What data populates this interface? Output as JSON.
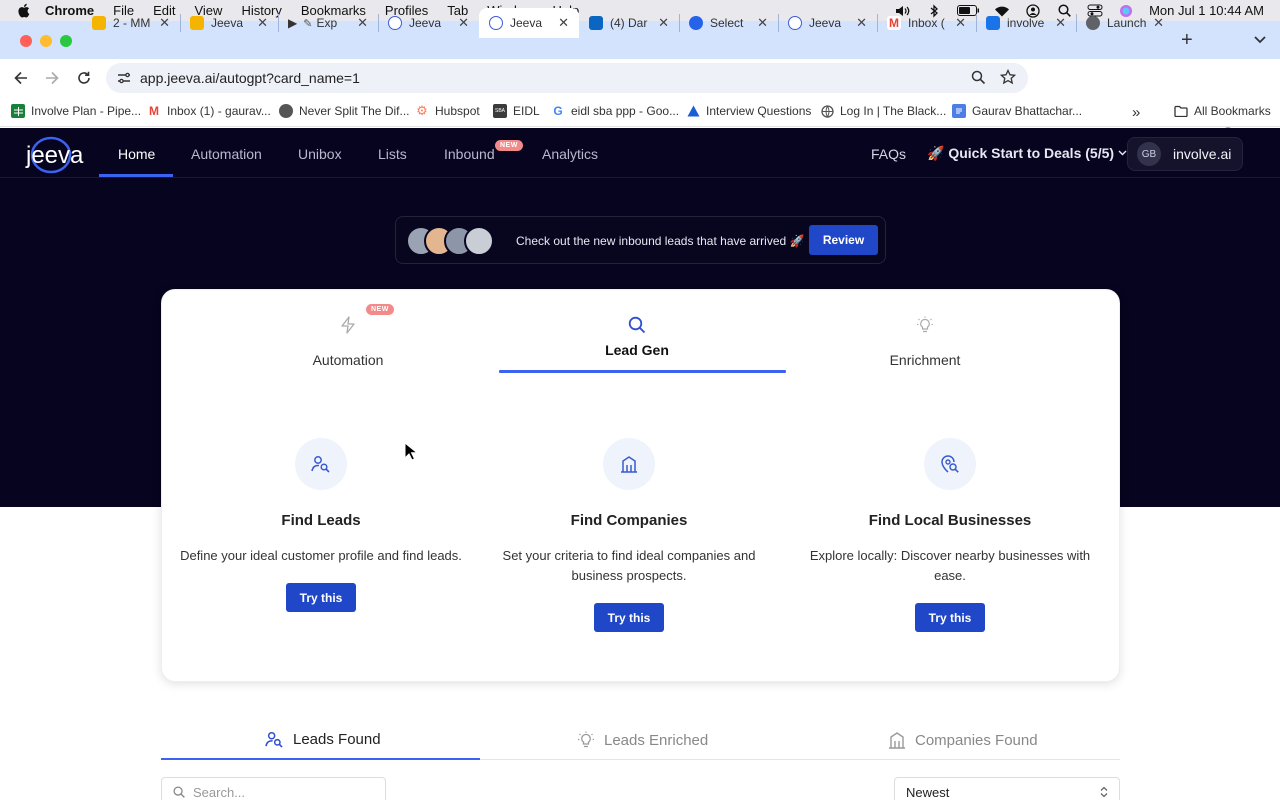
{
  "menubar": {
    "app": "Chrome",
    "items": [
      "File",
      "Edit",
      "View",
      "History",
      "Bookmarks",
      "Profiles",
      "Tab",
      "Window",
      "Help"
    ],
    "datetime": "Mon Jul 1  10:44 AM"
  },
  "tabs": [
    {
      "title": "2 - MM",
      "color": "#f4b400"
    },
    {
      "title": "Jeeva",
      "color": "#f4b400"
    },
    {
      "title": "Exp",
      "color": "#111111"
    },
    {
      "title": "Jeeva",
      "color": "#3c5bd6"
    },
    {
      "title": "Jeeva",
      "color": "#3c5bd6",
      "active": true
    },
    {
      "title": "(4) Dar",
      "color": "#0a66c2"
    },
    {
      "title": "Select",
      "color": "#2563eb"
    },
    {
      "title": "Jeeva",
      "color": "#3c5bd6"
    },
    {
      "title": "Inbox (",
      "color": "#ea4335"
    },
    {
      "title": "involve",
      "color": "#1a73e8"
    },
    {
      "title": "Launch",
      "color": "#5f6368"
    }
  ],
  "toolbar": {
    "url": "app.jeeva.ai/autogpt?card_name=1"
  },
  "bookmarks": {
    "items": [
      "Involve Plan - Pipe...",
      "Inbox (1) - gaurav...",
      "Never Split The Dif...",
      "Hubspot",
      "EIDL",
      "eidl sba ppp - Goo...",
      "Interview Questions",
      "Log In | The Black...",
      "Gaurav Bhattachar..."
    ],
    "all_label": "All Bookmarks",
    "more": "»"
  },
  "nav": {
    "logo_text": "jeeva",
    "links": [
      "Home",
      "Automation",
      "Unibox",
      "Lists",
      "Inbound",
      "Analytics"
    ],
    "new_badge": "NEW",
    "faqs": "FAQs",
    "quick_start": "🚀 Quick Start to Deals (5/5)",
    "org_initials": "GB",
    "org_name": "involve.ai"
  },
  "banner": {
    "text": "Check out the new inbound leads that have arrived 🚀",
    "button": "Review"
  },
  "card": {
    "tabs": [
      {
        "label": "Automation",
        "icon": "lightning-icon",
        "badge": "NEW"
      },
      {
        "label": "Lead Gen",
        "icon": "search-icon",
        "active": true
      },
      {
        "label": "Enrichment",
        "icon": "lightbulb-icon"
      }
    ],
    "features": [
      {
        "title": "Find Leads",
        "desc": "Define your ideal customer profile and find leads.",
        "button": "Try this",
        "icon": "user-search-icon"
      },
      {
        "title": "Find Companies",
        "desc": "Set your criteria to find ideal companies and business prospects.",
        "button": "Try this",
        "icon": "building-icon"
      },
      {
        "title": "Find Local Businesses",
        "desc": "Explore locally: Discover nearby businesses with ease.",
        "button": "Try this",
        "icon": "location-search-icon"
      }
    ]
  },
  "results": {
    "tabs": [
      "Leads Found",
      "Leads Enriched",
      "Companies Found"
    ],
    "search_placeholder": "Search...",
    "sort_value": "Newest"
  },
  "colors": {
    "brand_blue": "#1f47c8",
    "accent_blue": "#3b62f0",
    "dark_bg": "#06041e"
  }
}
